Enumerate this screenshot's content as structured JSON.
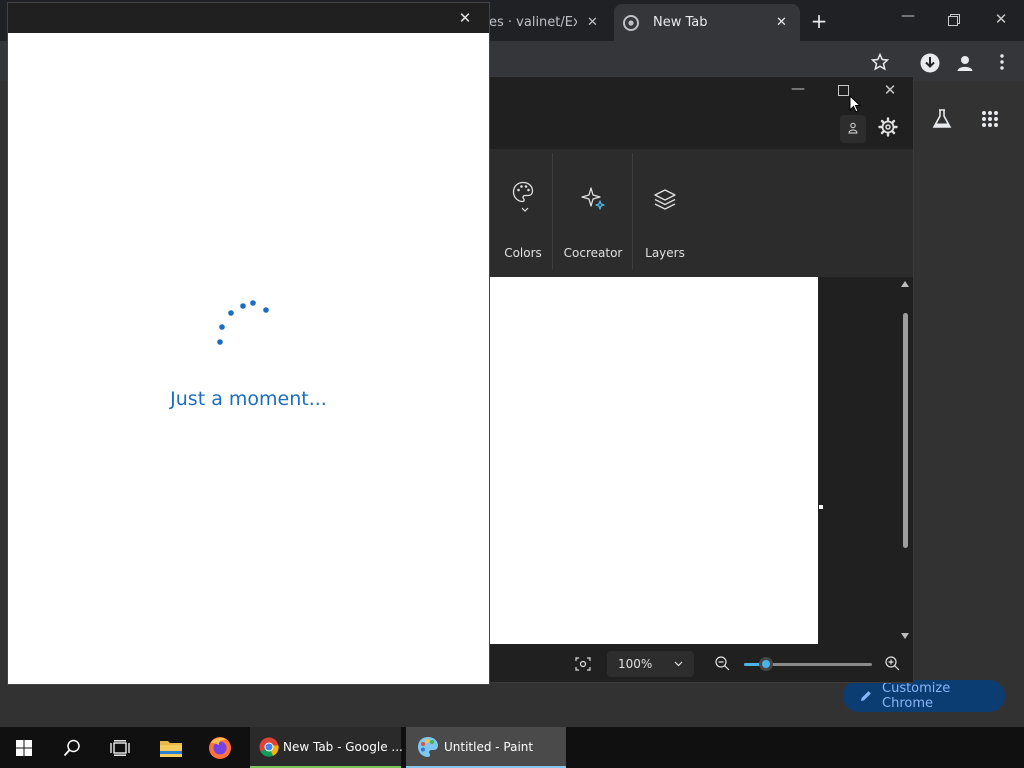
{
  "chrome": {
    "tabs": [
      {
        "title": "es · valinet/Explo"
      },
      {
        "title": "New Tab"
      }
    ],
    "customize_label": "Customize Chrome",
    "colors": {
      "frame": "#202124",
      "toolbar": "#35363a",
      "accent": "#8ab4f8",
      "button_bg": "#0b3d73"
    }
  },
  "paint": {
    "ribbon": [
      {
        "label": "Colors",
        "icon": "palette-icon"
      },
      {
        "label": "Cocreator",
        "icon": "sparkle-icon"
      },
      {
        "label": "Layers",
        "icon": "layers-icon"
      }
    ],
    "zoom": {
      "value": "100%",
      "slider_fraction": 0.17
    }
  },
  "dialog": {
    "message": "Just a moment...",
    "colors": {
      "accent": "#1a6dc2"
    }
  },
  "taskbar": {
    "items": [
      {
        "label": "New Tab - Google ..."
      },
      {
        "label": "Untitled - Paint"
      }
    ]
  }
}
